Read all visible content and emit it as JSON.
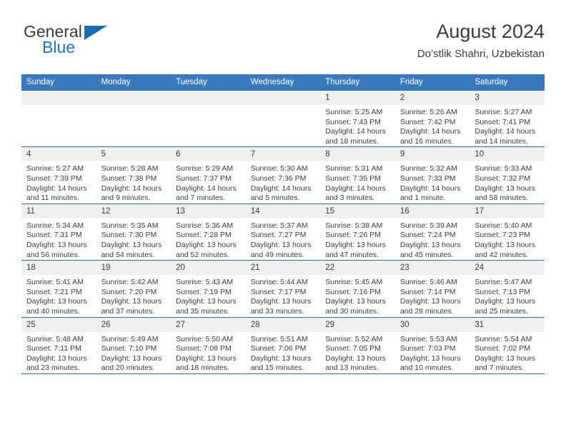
{
  "brand": {
    "name_top": "General",
    "name_bottom": "Blue",
    "triangle_color": "#1b6cb0",
    "blue": "#1b75bb"
  },
  "header": {
    "title": "August 2024",
    "subtitle": "Do’stlik Shahri, Uzbekistan"
  },
  "colors": {
    "header_bar": "#3a79bd",
    "row_divider": "#2a6db3",
    "daynum_strip": "#efefef",
    "text": "#3c3c3c"
  },
  "weekdays": [
    "Sunday",
    "Monday",
    "Tuesday",
    "Wednesday",
    "Thursday",
    "Friday",
    "Saturday"
  ],
  "weeks": [
    [
      {
        "day": "",
        "empty": true
      },
      {
        "day": "",
        "empty": true
      },
      {
        "day": "",
        "empty": true
      },
      {
        "day": "",
        "empty": true
      },
      {
        "day": "1",
        "sunrise": "Sunrise: 5:25 AM",
        "sunset": "Sunset: 7:43 PM",
        "daylight": "Daylight: 14 hours and 18 minutes."
      },
      {
        "day": "2",
        "sunrise": "Sunrise: 5:26 AM",
        "sunset": "Sunset: 7:42 PM",
        "daylight": "Daylight: 14 hours and 16 minutes."
      },
      {
        "day": "3",
        "sunrise": "Sunrise: 5:27 AM",
        "sunset": "Sunset: 7:41 PM",
        "daylight": "Daylight: 14 hours and 14 minutes."
      }
    ],
    [
      {
        "day": "4",
        "sunrise": "Sunrise: 5:27 AM",
        "sunset": "Sunset: 7:39 PM",
        "daylight": "Daylight: 14 hours and 11 minutes."
      },
      {
        "day": "5",
        "sunrise": "Sunrise: 5:28 AM",
        "sunset": "Sunset: 7:38 PM",
        "daylight": "Daylight: 14 hours and 9 minutes."
      },
      {
        "day": "6",
        "sunrise": "Sunrise: 5:29 AM",
        "sunset": "Sunset: 7:37 PM",
        "daylight": "Daylight: 14 hours and 7 minutes."
      },
      {
        "day": "7",
        "sunrise": "Sunrise: 5:30 AM",
        "sunset": "Sunset: 7:36 PM",
        "daylight": "Daylight: 14 hours and 5 minutes."
      },
      {
        "day": "8",
        "sunrise": "Sunrise: 5:31 AM",
        "sunset": "Sunset: 7:35 PM",
        "daylight": "Daylight: 14 hours and 3 minutes."
      },
      {
        "day": "9",
        "sunrise": "Sunrise: 5:32 AM",
        "sunset": "Sunset: 7:33 PM",
        "daylight": "Daylight: 14 hours and 1 minute."
      },
      {
        "day": "10",
        "sunrise": "Sunrise: 5:33 AM",
        "sunset": "Sunset: 7:32 PM",
        "daylight": "Daylight: 13 hours and 58 minutes."
      }
    ],
    [
      {
        "day": "11",
        "sunrise": "Sunrise: 5:34 AM",
        "sunset": "Sunset: 7:31 PM",
        "daylight": "Daylight: 13 hours and 56 minutes."
      },
      {
        "day": "12",
        "sunrise": "Sunrise: 5:35 AM",
        "sunset": "Sunset: 7:30 PM",
        "daylight": "Daylight: 13 hours and 54 minutes."
      },
      {
        "day": "13",
        "sunrise": "Sunrise: 5:36 AM",
        "sunset": "Sunset: 7:28 PM",
        "daylight": "Daylight: 13 hours and 52 minutes."
      },
      {
        "day": "14",
        "sunrise": "Sunrise: 5:37 AM",
        "sunset": "Sunset: 7:27 PM",
        "daylight": "Daylight: 13 hours and 49 minutes."
      },
      {
        "day": "15",
        "sunrise": "Sunrise: 5:38 AM",
        "sunset": "Sunset: 7:26 PM",
        "daylight": "Daylight: 13 hours and 47 minutes."
      },
      {
        "day": "16",
        "sunrise": "Sunrise: 5:39 AM",
        "sunset": "Sunset: 7:24 PM",
        "daylight": "Daylight: 13 hours and 45 minutes."
      },
      {
        "day": "17",
        "sunrise": "Sunrise: 5:40 AM",
        "sunset": "Sunset: 7:23 PM",
        "daylight": "Daylight: 13 hours and 42 minutes."
      }
    ],
    [
      {
        "day": "18",
        "sunrise": "Sunrise: 5:41 AM",
        "sunset": "Sunset: 7:21 PM",
        "daylight": "Daylight: 13 hours and 40 minutes."
      },
      {
        "day": "19",
        "sunrise": "Sunrise: 5:42 AM",
        "sunset": "Sunset: 7:20 PM",
        "daylight": "Daylight: 13 hours and 37 minutes."
      },
      {
        "day": "20",
        "sunrise": "Sunrise: 5:43 AM",
        "sunset": "Sunset: 7:19 PM",
        "daylight": "Daylight: 13 hours and 35 minutes."
      },
      {
        "day": "21",
        "sunrise": "Sunrise: 5:44 AM",
        "sunset": "Sunset: 7:17 PM",
        "daylight": "Daylight: 13 hours and 33 minutes."
      },
      {
        "day": "22",
        "sunrise": "Sunrise: 5:45 AM",
        "sunset": "Sunset: 7:16 PM",
        "daylight": "Daylight: 13 hours and 30 minutes."
      },
      {
        "day": "23",
        "sunrise": "Sunrise: 5:46 AM",
        "sunset": "Sunset: 7:14 PM",
        "daylight": "Daylight: 13 hours and 28 minutes."
      },
      {
        "day": "24",
        "sunrise": "Sunrise: 5:47 AM",
        "sunset": "Sunset: 7:13 PM",
        "daylight": "Daylight: 13 hours and 25 minutes."
      }
    ],
    [
      {
        "day": "25",
        "sunrise": "Sunrise: 5:48 AM",
        "sunset": "Sunset: 7:11 PM",
        "daylight": "Daylight: 13 hours and 23 minutes."
      },
      {
        "day": "26",
        "sunrise": "Sunrise: 5:49 AM",
        "sunset": "Sunset: 7:10 PM",
        "daylight": "Daylight: 13 hours and 20 minutes."
      },
      {
        "day": "27",
        "sunrise": "Sunrise: 5:50 AM",
        "sunset": "Sunset: 7:08 PM",
        "daylight": "Daylight: 13 hours and 18 minutes."
      },
      {
        "day": "28",
        "sunrise": "Sunrise: 5:51 AM",
        "sunset": "Sunset: 7:06 PM",
        "daylight": "Daylight: 13 hours and 15 minutes."
      },
      {
        "day": "29",
        "sunrise": "Sunrise: 5:52 AM",
        "sunset": "Sunset: 7:05 PM",
        "daylight": "Daylight: 13 hours and 13 minutes."
      },
      {
        "day": "30",
        "sunrise": "Sunrise: 5:53 AM",
        "sunset": "Sunset: 7:03 PM",
        "daylight": "Daylight: 13 hours and 10 minutes."
      },
      {
        "day": "31",
        "sunrise": "Sunrise: 5:54 AM",
        "sunset": "Sunset: 7:02 PM",
        "daylight": "Daylight: 13 hours and 7 minutes."
      }
    ]
  ]
}
